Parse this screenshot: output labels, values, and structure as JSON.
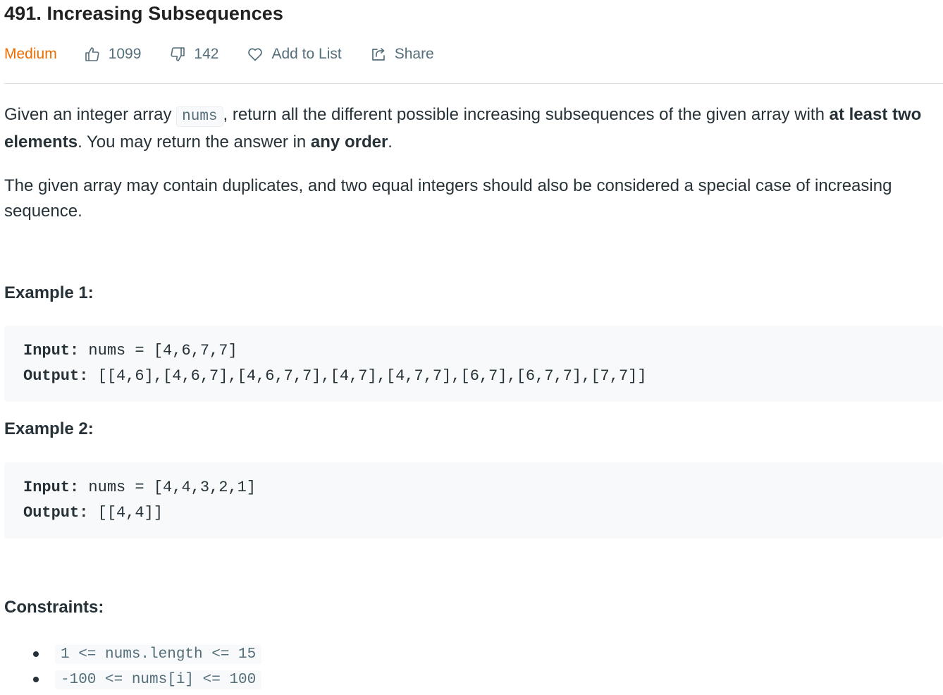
{
  "problem": {
    "title": "491. Increasing Subsequences",
    "difficulty": "Medium",
    "likes": "1099",
    "dislikes": "142",
    "add_to_list_label": "Add to List",
    "share_label": "Share"
  },
  "description": {
    "p1_pre": "Given an integer array ",
    "p1_code": "nums",
    "p1_mid": ", return all the different possible increasing subsequences of the given array with ",
    "p1_bold1": "at least two elements",
    "p1_mid2": ". You may return the answer in ",
    "p1_bold2": "any order",
    "p1_end": ".",
    "p2": "The given array may contain duplicates, and two equal integers should also be considered a special case of increasing sequence."
  },
  "examples": [
    {
      "heading": "Example 1:",
      "input_label": "Input:",
      "input_value": " nums = [4,6,7,7]",
      "output_label": "Output:",
      "output_value": " [[4,6],[4,6,7],[4,6,7,7],[4,7],[4,7,7],[6,7],[6,7,7],[7,7]]"
    },
    {
      "heading": "Example 2:",
      "input_label": "Input:",
      "input_value": " nums = [4,4,3,2,1]",
      "output_label": "Output:",
      "output_value": " [[4,4]]"
    }
  ],
  "constraints": {
    "heading": "Constraints:",
    "items": [
      "1 <= nums.length <= 15",
      "-100 <= nums[i] <= 100"
    ]
  },
  "colors": {
    "difficulty_medium": "#ef6c00",
    "meta_text": "#546e7a",
    "body_text": "#263238",
    "code_bg": "#f7f9fa"
  },
  "icons": [
    "thumbs-up-icon",
    "thumbs-down-icon",
    "heart-icon",
    "share-icon"
  ]
}
